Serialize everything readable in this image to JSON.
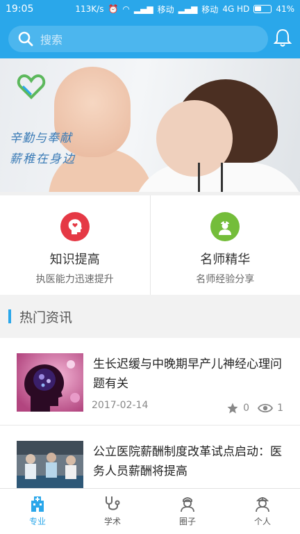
{
  "status_bar": {
    "time": "19:05",
    "speed": "113K/s",
    "carrier1": "移动",
    "carrier2": "移动",
    "network": "4G HD",
    "battery": "41%"
  },
  "search": {
    "placeholder": "搜索",
    "icon": "search-icon"
  },
  "header": {
    "bell_icon": "bell-icon"
  },
  "banner": {
    "slogan_line1": "辛勤与奉献",
    "slogan_line2": "薪稚在身边"
  },
  "cards": [
    {
      "title": "知识提高",
      "subtitle": "执医能力迅速提升",
      "icon": "head-heart-icon",
      "color": "#e53945"
    },
    {
      "title": "名师精华",
      "subtitle": "名师经验分享",
      "icon": "doctor-icon",
      "color": "#74bd3a"
    }
  ],
  "section": {
    "title": "热门资讯"
  },
  "news": [
    {
      "headline": "生长迟缓与中晚期早产儿神经心理问题有关",
      "date": "2017-02-14",
      "stars": "0",
      "views": "1"
    },
    {
      "headline": "公立医院薪酬制度改革试点启动：医务人员薪酬将提高",
      "date": "",
      "stars": "",
      "views": ""
    }
  ],
  "tabs": [
    {
      "label": "专业",
      "icon": "hospital-icon",
      "active": true
    },
    {
      "label": "学术",
      "icon": "stethoscope-icon",
      "active": false
    },
    {
      "label": "圈子",
      "icon": "nurse-icon",
      "active": false
    },
    {
      "label": "个人",
      "icon": "doctor-profile-icon",
      "active": false
    }
  ],
  "colors": {
    "primary": "#2aa7ea"
  }
}
